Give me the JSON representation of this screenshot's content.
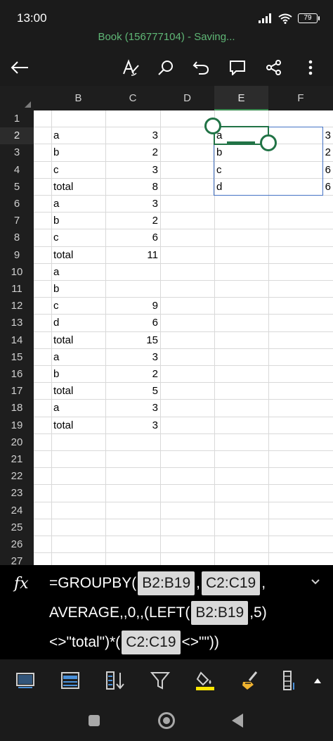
{
  "status": {
    "time": "13:00",
    "battery": "79"
  },
  "document": {
    "title": "Book (156777104) - Saving..."
  },
  "toolbar": {
    "icons": [
      "back-arrow-icon",
      "format-text-icon",
      "search-icon",
      "undo-icon",
      "comment-icon",
      "share-icon",
      "more-vertical-icon"
    ]
  },
  "sheet": {
    "columns": [
      "B",
      "C",
      "D",
      "E",
      "F"
    ],
    "selected_column": "E",
    "rows": [
      "1",
      "2",
      "3",
      "4",
      "5",
      "6",
      "7",
      "8",
      "9",
      "10",
      "11",
      "12",
      "13",
      "14",
      "15",
      "16",
      "17",
      "18",
      "19",
      "20",
      "21",
      "22",
      "23",
      "24",
      "25",
      "26",
      "27"
    ],
    "selected_row": "2",
    "data": {
      "B": [
        "",
        "a",
        "b",
        "c",
        "total",
        "a",
        "b",
        "c",
        "total",
        "a",
        "b",
        "c",
        "d",
        "total",
        "a",
        "b",
        "total",
        "a",
        "total"
      ],
      "C": [
        "",
        "3",
        "2",
        "3",
        "8",
        "3",
        "2",
        "6",
        "11",
        "",
        "",
        "9",
        "6",
        "15",
        "3",
        "2",
        "5",
        "3",
        "3"
      ],
      "E": [
        "",
        "a",
        "b",
        "c",
        "d"
      ],
      "F": [
        "",
        "3",
        "2",
        "6",
        "6"
      ]
    }
  },
  "formula": {
    "line1_prefix": "=GROUPBY(",
    "ref1": "B2:B19",
    "sep1": ",",
    "ref2": "C2:C19",
    "sep2": ",",
    "line2_prefix": "AVERAGE,,0,,(LEFT(",
    "ref3": "B2:B19",
    "line2_suffix": ",5)",
    "line3_prefix": "<>\"total\")*(",
    "ref4": "C2:C19",
    "line3_suffix": "<>\"\"))"
  },
  "ribbon": {
    "icons": [
      "sheet-view-icon",
      "table-icon",
      "sort-icon",
      "filter-icon",
      "fill-color-icon",
      "format-painter-icon",
      "insert-column-icon",
      "expand-up-icon"
    ],
    "fill_accent": "#ffe600"
  },
  "colors": {
    "accent_green": "#217346",
    "spill_blue": "#4472c4",
    "title_green": "#5fb776"
  }
}
